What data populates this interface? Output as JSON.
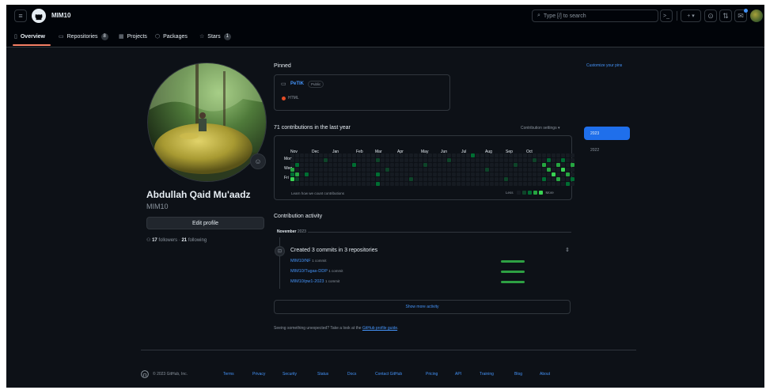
{
  "header": {
    "username": "MIM10",
    "search_placeholder": "Type [/] to search",
    "plus_label": "+ ▾"
  },
  "tabs": [
    {
      "label": "Overview",
      "count": ""
    },
    {
      "label": "Repositories",
      "count": "8"
    },
    {
      "label": "Projects",
      "count": ""
    },
    {
      "label": "Packages",
      "count": ""
    },
    {
      "label": "Stars",
      "count": "1"
    }
  ],
  "profile": {
    "name": "Abdullah Qaid Mu'aadz",
    "username": "MIM10",
    "edit_label": "Edit profile",
    "followers_count": "17",
    "followers_label": "followers",
    "following_count": "21",
    "following_label": "following",
    "separator": "·"
  },
  "pinned": {
    "title": "Pinned",
    "customize": "Customize your pins",
    "repo_name": "PeTIK",
    "repo_badge": "Public",
    "language": "HTML",
    "language_color": "#e34c26"
  },
  "contributions": {
    "title": "71 contributions in the last year",
    "settings": "Contribution settings ▾",
    "months": [
      "Nov",
      "Dec",
      "Jan",
      "Feb",
      "Mar",
      "Apr",
      "May",
      "Jun",
      "Jul",
      "Aug",
      "Sep",
      "Oct"
    ],
    "days": [
      "Mon",
      "Wed",
      "Fri"
    ],
    "learn": "Learn how we count contributions",
    "less": "Less",
    "more": "More",
    "colors": [
      "#161b22",
      "#0e4429",
      "#006d32",
      "#26a641",
      "#39d353"
    ]
  },
  "years": [
    "2023",
    "2022"
  ],
  "activity": {
    "title": "Contribution activity",
    "month": "November",
    "year": "2023",
    "event": "Created 3 commits in 3 repositories",
    "repos": [
      {
        "name": "MIM10/NF",
        "commits": "1 commit"
      },
      {
        "name": "MIM10/Tugas-DDP",
        "commits": "1 commit"
      },
      {
        "name": "MIM10/pw1-2023",
        "commits": "1 commit"
      }
    ],
    "show_more": "Show more activity",
    "unexpected": "Seeing something unexpected? Take a look at the",
    "guide": "GitHub profile guide",
    "period": "."
  },
  "footer": {
    "copyright": "© 2023 GitHub, Inc.",
    "links": [
      "Terms",
      "Privacy",
      "Security",
      "Status",
      "Docs",
      "Contact GitHub",
      "Pricing",
      "API",
      "Training",
      "Blog",
      "About"
    ]
  }
}
